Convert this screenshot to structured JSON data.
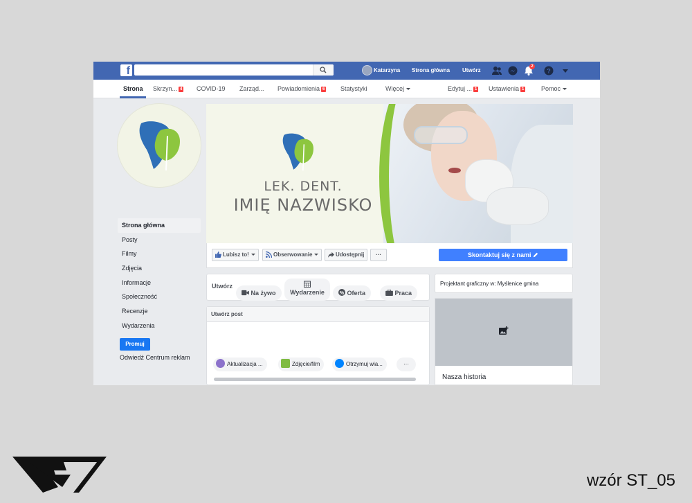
{
  "topbar": {
    "user_name": "Katarzyna",
    "home": "Strona główna",
    "create": "Utwórz",
    "notif_count": "2"
  },
  "pagenav": {
    "items": [
      {
        "label": "Strona"
      },
      {
        "label": "Skrzyn...",
        "badge": "4"
      },
      {
        "label": "COVID-19"
      },
      {
        "label": "Zarząd..."
      },
      {
        "label": "Powiadomienia",
        "badge": "6"
      },
      {
        "label": "Statystyki"
      },
      {
        "label": "Więcej"
      },
      {
        "label": "Edytuj ...",
        "badge": "1"
      },
      {
        "label": "Ustawienia",
        "badge": "1"
      },
      {
        "label": "Pomoc"
      }
    ]
  },
  "left_menu": {
    "items": [
      "Strona główna",
      "Posty",
      "Filmy",
      "Zdjęcia",
      "Informacje",
      "Społeczność",
      "Recenzje",
      "Wydarzenia"
    ],
    "promote": "Promuj",
    "ads_link": "Odwiedź Centrum reklam"
  },
  "cover": {
    "line1": "LEK. DENT.",
    "line2": "IMIĘ NAZWISKO"
  },
  "actions": {
    "like": "Lubisz to!",
    "follow": "Obserwowanie",
    "share": "Udostępnij",
    "more": "···",
    "contact": "Skontaktuj się z nami"
  },
  "create_bar": {
    "label": "Utwórz",
    "live": "Na żywo",
    "event": "Wydarzenie",
    "offer": "Oferta",
    "job": "Praca"
  },
  "composer": {
    "title": "Utwórz post",
    "update": "Aktualizacja ...",
    "photo": "Zdjęcie/film",
    "messages": "Otrzymuj wia...",
    "more": "···"
  },
  "right": {
    "category": "Projektant graficzny w: Myślenice gmina",
    "story_title": "Nasza historia"
  },
  "caption": "wzór ST_05",
  "colors": {
    "fb_blue": "#4267b2",
    "accent_green": "#8dc63f",
    "tooth_blue": "#2f6fb7",
    "contact_blue": "#4080ff"
  }
}
